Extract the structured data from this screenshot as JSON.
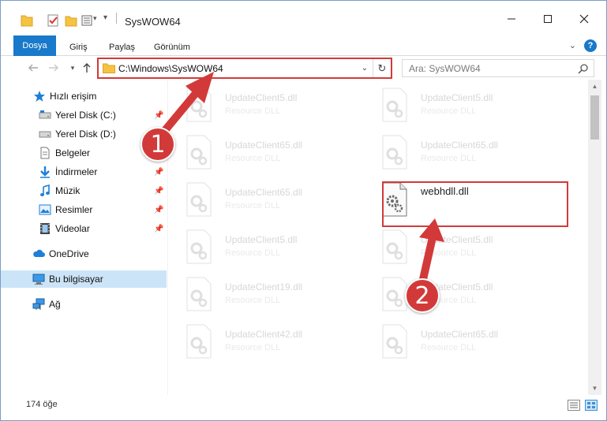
{
  "window": {
    "title": "SysWOW64",
    "minimize_icon": "minimize-icon",
    "maximize_icon": "maximize-icon",
    "close_icon": "close-icon"
  },
  "ribbon": {
    "tabs": [
      {
        "label": "Dosya",
        "active": true
      },
      {
        "label": "Giriş"
      },
      {
        "label": "Paylaş"
      },
      {
        "label": "Görünüm"
      }
    ]
  },
  "address": {
    "path": "C:\\Windows\\SysWOW64"
  },
  "search": {
    "placeholder": "Ara: SysWOW64"
  },
  "sidebar": {
    "items": [
      {
        "label": "Hızlı erişim",
        "icon": "star-icon"
      },
      {
        "label": "Yerel Disk (C:)",
        "icon": "drive-icon",
        "pinned": true
      },
      {
        "label": "Yerel Disk (D:)",
        "icon": "drive-icon"
      },
      {
        "label": "Belgeler",
        "icon": "documents-icon"
      },
      {
        "label": "İndirmeler",
        "icon": "downloads-icon",
        "pinned": true
      },
      {
        "label": "Müzik",
        "icon": "music-icon",
        "pinned": true
      },
      {
        "label": "Resimler",
        "icon": "pictures-icon",
        "pinned": true
      },
      {
        "label": "Videolar",
        "icon": "videos-icon",
        "pinned": true
      },
      {
        "label": "OneDrive",
        "icon": "cloud-icon"
      },
      {
        "label": "Bu bilgisayar",
        "icon": "computer-icon",
        "selected": true
      },
      {
        "label": "Ağ",
        "icon": "network-icon"
      }
    ]
  },
  "files": [
    {
      "name": "UpdateClient5.dll",
      "type": "Resource DLL"
    },
    {
      "name": "UpdateClient5.dll",
      "type": "Resource DLL"
    },
    {
      "name": "UpdateClient65.dll",
      "type": "Resource DLL"
    },
    {
      "name": "UpdateClient65.dll",
      "type": "Resource DLL"
    },
    {
      "name": "UpdateClient65.dll",
      "type": "Resource DLL"
    },
    {
      "name": "webhdll.dll",
      "type": "",
      "highlighted": true
    },
    {
      "name": "UpdateClient5.dll",
      "type": "Resource DLL"
    },
    {
      "name": "UpdateClient5.dll",
      "type": "Resource DLL"
    },
    {
      "name": "UpdateClient19.dll",
      "type": "Resource DLL"
    },
    {
      "name": "UpdateClient5.dll",
      "type": "Resource DLL"
    },
    {
      "name": "UpdateClient42.dll",
      "type": "Resource DLL"
    },
    {
      "name": "UpdateClient65.dll",
      "type": "Resource DLL"
    }
  ],
  "status": {
    "count": "174 öğe"
  },
  "annotations": {
    "step1": "1",
    "step2": "2",
    "color": "#d23a3a"
  },
  "colors": {
    "accent": "#1979ca",
    "selection": "#cce4f7"
  }
}
